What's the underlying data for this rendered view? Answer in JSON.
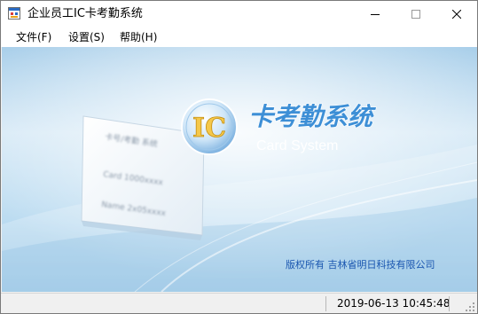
{
  "window": {
    "title": "企业员工IC卡考勤系统"
  },
  "menu": {
    "file": "文件(F)",
    "settings": "设置(S)",
    "help": "帮助(H)"
  },
  "banner": {
    "logo_letters": "IC",
    "heading": "卡考勤系统",
    "subheading": "Card System",
    "card_lines": [
      "卡号/考勤 系统",
      "Card  1000xxxx",
      "Name  2x05xxxx"
    ],
    "copyright": "版权所有  吉林省明日科技有限公司"
  },
  "status": {
    "datetime": "2019-06-13 10:45:48"
  },
  "colors": {
    "banner_light": "#e8f3fb",
    "banner_mid": "#a9cfea",
    "heading_blue": "#3d8fd6",
    "copyright_blue": "#1a56b0",
    "logo_gold": "#f5c84a"
  },
  "icons": {
    "app": "app-window-icon",
    "minimize": "minimize-icon",
    "maximize": "maximize-icon",
    "close": "close-icon"
  }
}
